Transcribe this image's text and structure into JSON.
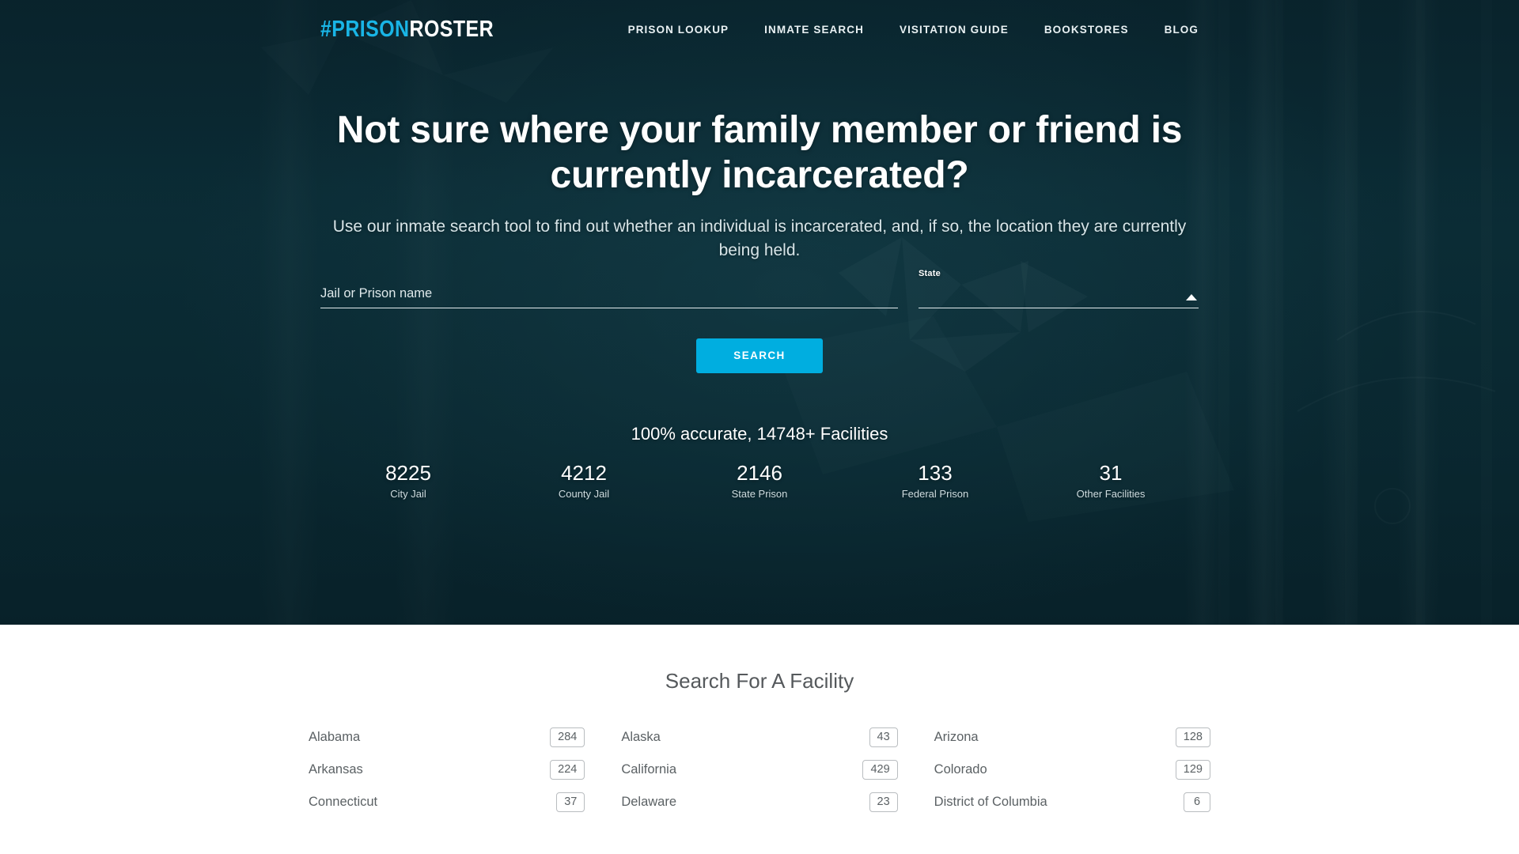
{
  "brand": {
    "logo_hash": "#PRISON",
    "logo_roster": "ROSTER",
    "accent_color": "#00aee0",
    "logo_accent_color": "#19b5e6",
    "hero_bg_color": "#0b2b34"
  },
  "nav": {
    "items": [
      {
        "label": "PRISON LOOKUP"
      },
      {
        "label": "INMATE SEARCH"
      },
      {
        "label": "VISITATION GUIDE"
      },
      {
        "label": "BOOKSTORES"
      },
      {
        "label": "BLOG"
      }
    ]
  },
  "hero": {
    "headline": "Not sure where your family member or friend is currently incarcerated?",
    "subhead": "Use our inmate search tool to find out whether an individual is incarcerated, and, if so, the location they are currently being held.",
    "search": {
      "name_placeholder": "Jail or Prison name",
      "name_value": "",
      "state_label": "State",
      "state_value": "",
      "state_caret_icon": "chevron-up-icon",
      "button_label": "SEARCH"
    },
    "accuracy_text": "100% accurate, 14748+ Facilities",
    "stats": [
      {
        "value": "8225",
        "label": "City Jail"
      },
      {
        "value": "4212",
        "label": "County Jail"
      },
      {
        "value": "2146",
        "label": "State Prison"
      },
      {
        "value": "133",
        "label": "Federal Prison"
      },
      {
        "value": "31",
        "label": "Other Facilities"
      }
    ]
  },
  "facilities": {
    "title": "Search For A Facility",
    "rows": [
      {
        "name": "Alabama",
        "count": "284"
      },
      {
        "name": "Alaska",
        "count": "43"
      },
      {
        "name": "Arizona",
        "count": "128"
      },
      {
        "name": "Arkansas",
        "count": "224"
      },
      {
        "name": "California",
        "count": "429"
      },
      {
        "name": "Colorado",
        "count": "129"
      },
      {
        "name": "Connecticut",
        "count": "37"
      },
      {
        "name": "Delaware",
        "count": "23"
      },
      {
        "name": "District of Columbia",
        "count": "6"
      }
    ]
  }
}
